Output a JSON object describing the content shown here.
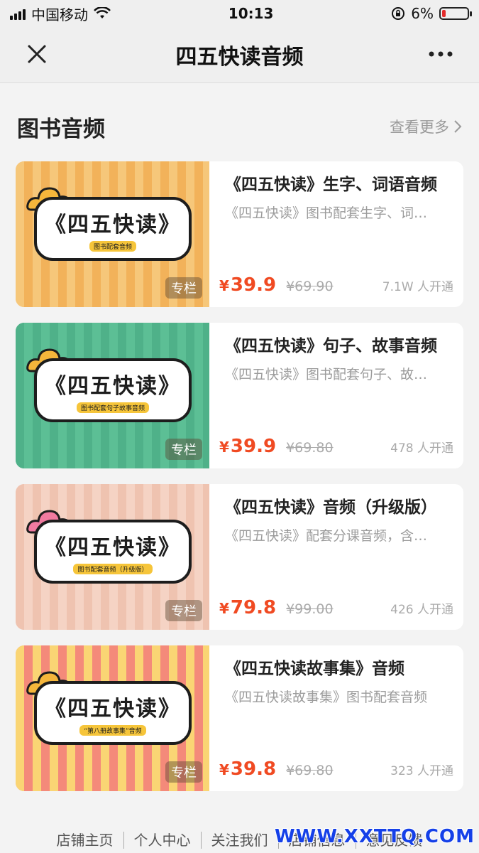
{
  "status": {
    "carrier": "中国移动",
    "time": "10:13",
    "battery": "6%"
  },
  "nav": {
    "title": "四五快读音频"
  },
  "section": {
    "title": "图书音频",
    "more": "查看更多"
  },
  "products": [
    {
      "title": "《四五快读》生字、词语音频",
      "desc": "《四五快读》图书配套生字、词…",
      "yen": "¥",
      "price": "39.9",
      "orig": "¥69.90",
      "subs": "7.1W 人开通",
      "badge": "专栏",
      "thumb_logo": "《四五快读》",
      "thumb_sub": "图书配套音频",
      "bg": "#f2b25a",
      "stripe": "#f6c77a",
      "cloud": "#f5b63b"
    },
    {
      "title": "《四五快读》句子、故事音频",
      "desc": "《四五快读》图书配套句子、故…",
      "yen": "¥",
      "price": "39.9",
      "orig": "¥69.80",
      "subs": "478 人开通",
      "badge": "专栏",
      "thumb_logo": "《四五快读》",
      "thumb_sub": "图书配套句子故事音频",
      "bg": "#5cbf95",
      "stripe": "#4fb189",
      "cloud": "#f5b63b"
    },
    {
      "title": "《四五快读》音频（升级版）",
      "desc": "《四五快读》配套分课音频，含…",
      "yen": "¥",
      "price": "79.8",
      "orig": "¥99.00",
      "subs": "426 人开通",
      "badge": "专栏",
      "thumb_logo": "《四五快读》",
      "thumb_sub": "图书配套音频（升级版）",
      "bg": "#f5d3c4",
      "stripe": "#efc3b0",
      "cloud": "#f07aa0"
    },
    {
      "title": "《四五快读故事集》音频",
      "desc": "《四五快读故事集》图书配套音频",
      "yen": "¥",
      "price": "39.8",
      "orig": "¥69.80",
      "subs": "323 人开通",
      "badge": "专栏",
      "thumb_logo": "《四五快读》",
      "thumb_sub": "“第八册故事集”音频",
      "bg": "#f48a7a",
      "stripe": "#fad574",
      "cloud": "#f5b63b"
    }
  ],
  "footer": [
    "店铺主页",
    "个人中心",
    "关注我们",
    "店铺信息",
    "意见反馈"
  ],
  "watermark": "WWW.XXTTQ.COM",
  "colors": {
    "accent": "#f04a22",
    "background": "#f3f3f3"
  }
}
